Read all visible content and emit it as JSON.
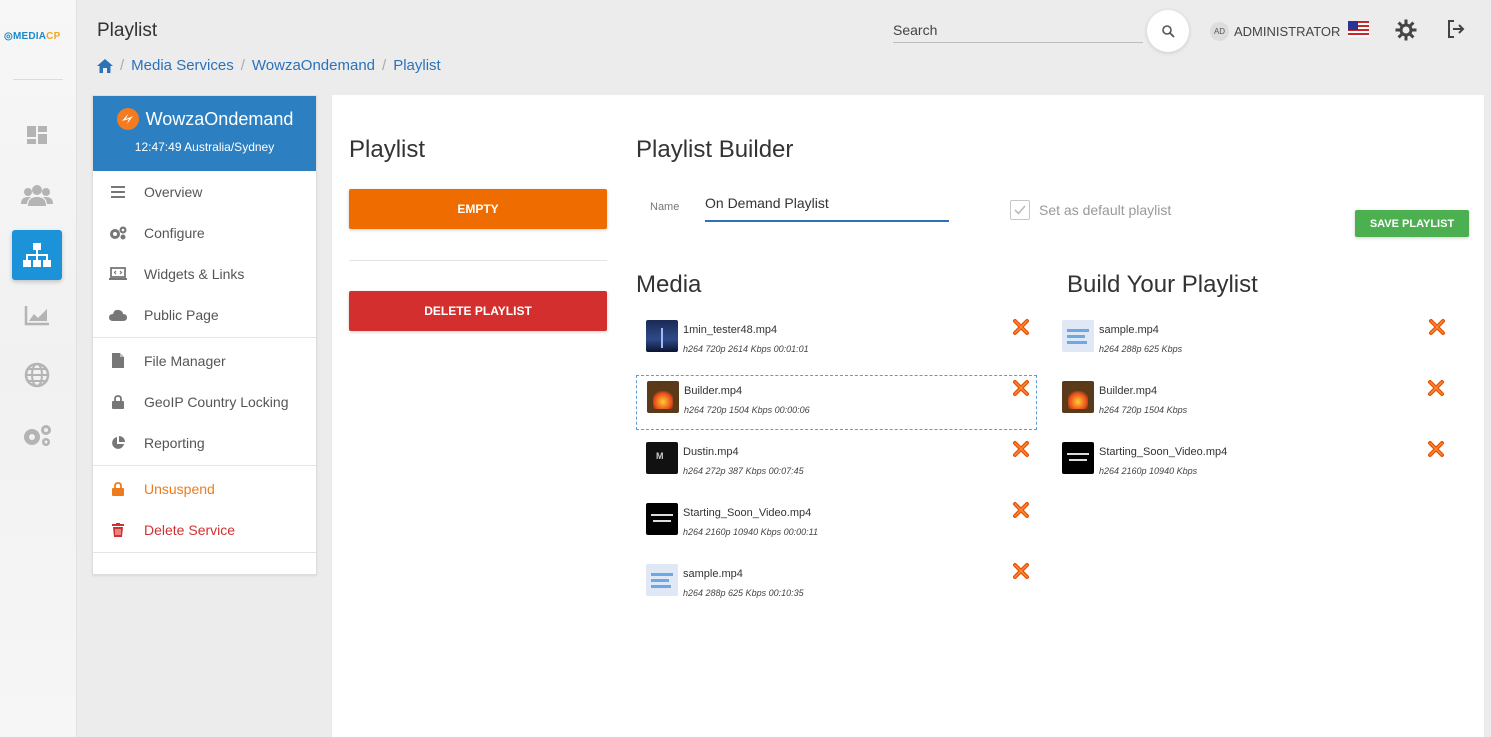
{
  "app": {
    "logo_text": "MEDIA",
    "logo_cp": "CP",
    "page_title": "Playlist"
  },
  "header": {
    "search_placeholder": "Search",
    "user_avatar": "AD",
    "user_name": "ADMINISTRATOR"
  },
  "breadcrumb": [
    "Media Services",
    "WowzaOndemand",
    "Playlist"
  ],
  "service": {
    "name": "WowzaOndemand",
    "time": "12:47:49 Australia/Sydney",
    "menu": [
      {
        "label": "Overview",
        "icon": "list-icon"
      },
      {
        "label": "Configure",
        "icon": "gears-icon"
      },
      {
        "label": "Widgets & Links",
        "icon": "laptop-code-icon"
      },
      {
        "label": "Public Page",
        "icon": "cloud-icon"
      },
      {
        "label": "File Manager",
        "icon": "file-icon"
      },
      {
        "label": "GeoIP Country Locking",
        "icon": "lock-icon"
      },
      {
        "label": "Reporting",
        "icon": "pie-chart-icon"
      },
      {
        "label": "Unsuspend",
        "icon": "unlock-icon"
      },
      {
        "label": "Delete Service",
        "icon": "trash-icon"
      }
    ]
  },
  "playlist": {
    "title": "Playlist",
    "empty_label": "EMPTY",
    "delete_label": "DELETE PLAYLIST"
  },
  "builder": {
    "title": "Playlist Builder",
    "name_label": "Name",
    "name_value": "On Demand Playlist",
    "default_label": "Set as default playlist",
    "save_label": "SAVE PLAYLIST"
  },
  "media": {
    "title": "Media",
    "items": [
      {
        "name": "1min_tester48.mp4",
        "meta": "h264 720p 2614 Kbps 00:01:01"
      },
      {
        "name": "Builder.mp4",
        "meta": "h264 720p 1504 Kbps 00:00:06"
      },
      {
        "name": "Dustin.mp4",
        "meta": "h264 272p 387 Kbps 00:07:45"
      },
      {
        "name": "Starting_Soon_Video.mp4",
        "meta": "h264 2160p 10940 Kbps 00:00:11"
      },
      {
        "name": "sample.mp4",
        "meta": "h264 288p 625 Kbps 00:10:35"
      }
    ]
  },
  "build": {
    "title": "Build Your Playlist",
    "items": [
      {
        "name": "sample.mp4",
        "meta": "h264 288p 625 Kbps"
      },
      {
        "name": "Builder.mp4",
        "meta": "h264 720p 1504 Kbps"
      },
      {
        "name": "Starting_Soon_Video.mp4",
        "meta": "h264 2160p 10940 Kbps"
      }
    ]
  },
  "colors": {
    "primary": "#2c7fc0",
    "empty_btn": "#ef6c00",
    "delete_btn": "#d32f2f",
    "save_btn": "#4caf50",
    "rail_active": "#1c93d8"
  }
}
